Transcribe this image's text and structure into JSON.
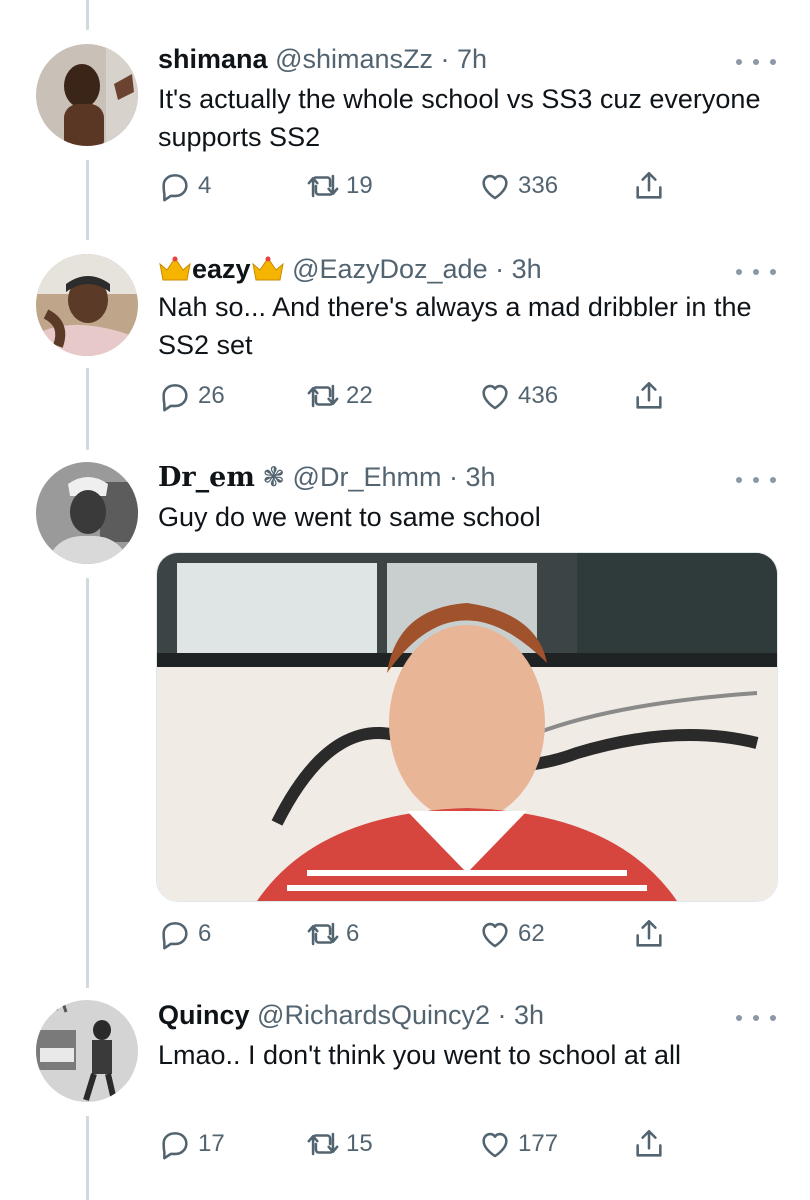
{
  "tweets": [
    {
      "display_name": "shimana",
      "handle_time": "@shimansZz · 7h",
      "text": "It's actually the whole school vs SS3 cuz everyone supports SS2",
      "replies": "4",
      "retweets": "19",
      "likes": "336"
    },
    {
      "display_name": "eazy",
      "handle_time": "@EazyDoz_ade · 3h",
      "text": "Nah so... And there's always a mad dribbler in the SS2 set",
      "replies": "26",
      "retweets": "22",
      "likes": "436"
    },
    {
      "display_name": "Dr_em",
      "name_suffix": "❃",
      "handle_time": "@Dr_Ehmm · 3h",
      "text": "Guy do we went to same school",
      "replies": "6",
      "retweets": "6",
      "likes": "62"
    },
    {
      "display_name": "Quincy",
      "handle_time": "@RichardsQuincy2 · 3h",
      "text": "Lmao.. I don't think you went to school at all",
      "replies": "17",
      "retweets": "15",
      "likes": "177"
    }
  ],
  "colors": {
    "text": "#0f1419",
    "secondary": "#536471",
    "thread": "#cfd9de",
    "crown": "#f5b400"
  },
  "icons": [
    "reply-icon",
    "retweet-icon",
    "like-icon",
    "share-icon",
    "more-icon",
    "crown-icon"
  ]
}
